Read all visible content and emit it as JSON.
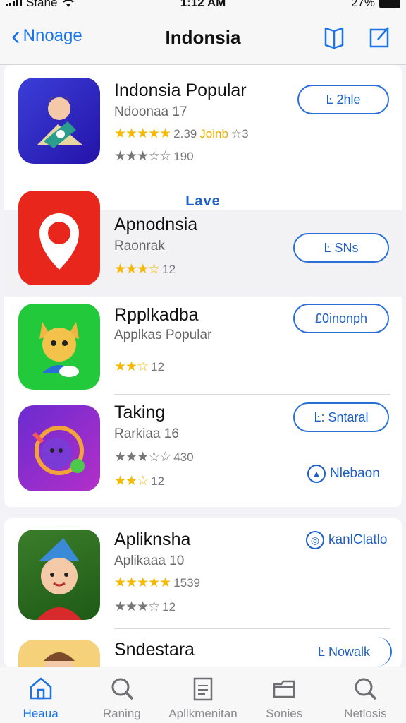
{
  "status_bar": {
    "carrier": "Stane",
    "time": "1:12 AM",
    "battery": "27%"
  },
  "nav": {
    "back_label": "Nnoage",
    "title": "Indonsia"
  },
  "section_label": "Lave",
  "apps": [
    {
      "name": "Indonsia Popular",
      "subtitle": "Ndoonaa 17",
      "rating_text": "2.39",
      "rating_extra": "Joinb",
      "rating_tail": "☆3",
      "count_text": "190",
      "action": "Ŀ 2hle",
      "stars1": "★★★★★",
      "stars2": "★★★☆☆"
    },
    {
      "name": "Apnodnsia",
      "subtitle": "Raonrak",
      "rating_text": "12",
      "action": "Ŀ SNs",
      "stars1": "★★★☆"
    },
    {
      "name": "Rpplkadba",
      "subtitle": "Applkas Popular",
      "rating_text": "12",
      "action": "£0inonph",
      "stars1": "★★☆"
    },
    {
      "name": "Taking",
      "subtitle": "Rarkiaa 16",
      "count_text": "430",
      "rating_text": "12",
      "action": "Ŀ: Sntaral",
      "secondary": "Nlebaon",
      "stars1": "★★★☆☆",
      "stars2": "★★☆"
    },
    {
      "name": "Apliknsha",
      "subtitle": "Aplikaaa 10",
      "rating_text": "1539",
      "count_text": "12",
      "action": "kanlClatlo",
      "stars1": "★★★★★",
      "stars2": "★★★☆"
    },
    {
      "name": "Sndestara",
      "action": "Ŀ Nowalk"
    }
  ],
  "tabs": [
    {
      "label": "Heaua",
      "icon": "home-icon",
      "active": true
    },
    {
      "label": "Raning",
      "icon": "search-icon",
      "active": false
    },
    {
      "label": "Apllkmenitan",
      "icon": "document-icon",
      "active": false
    },
    {
      "label": "Sonies",
      "icon": "folder-icon",
      "active": false
    },
    {
      "label": "Netlosis",
      "icon": "search-icon",
      "active": false
    }
  ],
  "colors": {
    "accent": "#1a73e8",
    "star": "#f5b800",
    "background": "#f2f2f7"
  }
}
